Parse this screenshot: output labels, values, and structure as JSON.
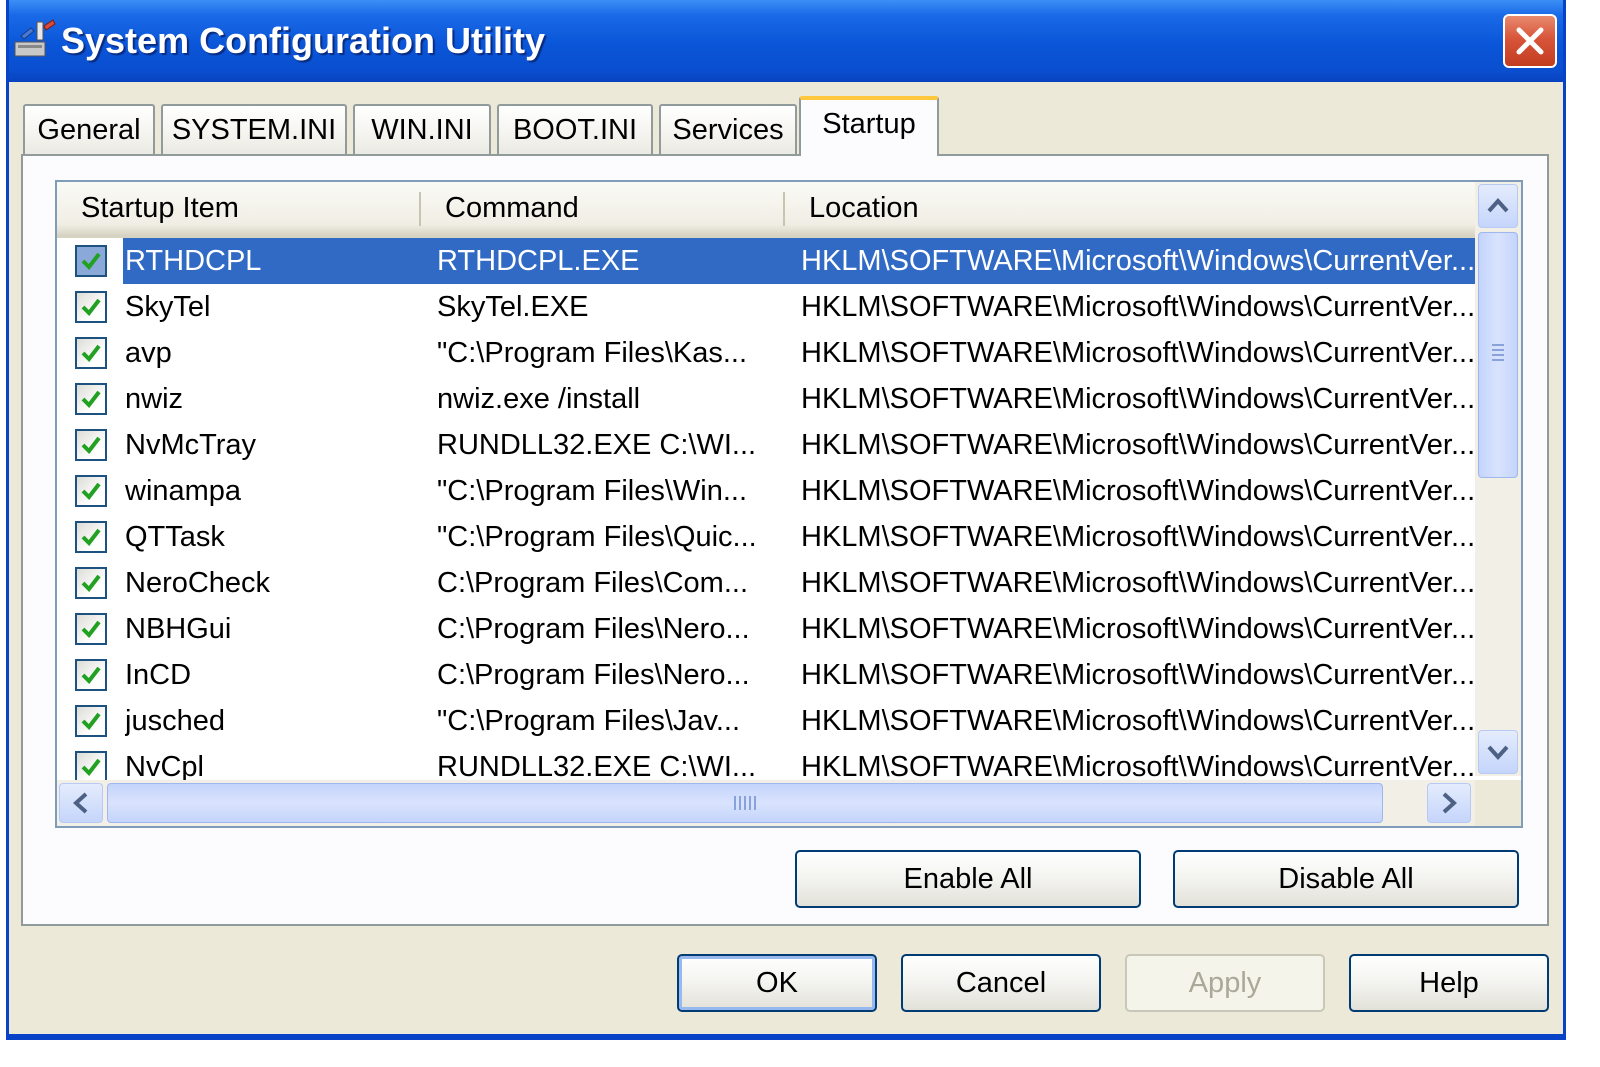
{
  "window": {
    "title": "System Configuration Utility"
  },
  "tabs": [
    {
      "label": "General",
      "active": false
    },
    {
      "label": "SYSTEM.INI",
      "active": false
    },
    {
      "label": "WIN.INI",
      "active": false
    },
    {
      "label": "BOOT.INI",
      "active": false
    },
    {
      "label": "Services",
      "active": false
    },
    {
      "label": "Startup",
      "active": true
    }
  ],
  "startup_list": {
    "columns": [
      "Startup Item",
      "Command",
      "Location"
    ],
    "rows": [
      {
        "checked": true,
        "item": "RTHDCPL",
        "command": "RTHDCPL.EXE",
        "location": "HKLM\\SOFTWARE\\Microsoft\\Windows\\CurrentVer...",
        "selected": true
      },
      {
        "checked": true,
        "item": "SkyTel",
        "command": "SkyTel.EXE",
        "location": "HKLM\\SOFTWARE\\Microsoft\\Windows\\CurrentVer..."
      },
      {
        "checked": true,
        "item": "avp",
        "command": "\"C:\\Program Files\\Kas...",
        "location": "HKLM\\SOFTWARE\\Microsoft\\Windows\\CurrentVer..."
      },
      {
        "checked": true,
        "item": "nwiz",
        "command": "nwiz.exe /install",
        "location": "HKLM\\SOFTWARE\\Microsoft\\Windows\\CurrentVer..."
      },
      {
        "checked": true,
        "item": "NvMcTray",
        "command": "RUNDLL32.EXE C:\\WI...",
        "location": "HKLM\\SOFTWARE\\Microsoft\\Windows\\CurrentVer..."
      },
      {
        "checked": true,
        "item": "winampa",
        "command": "\"C:\\Program Files\\Win...",
        "location": "HKLM\\SOFTWARE\\Microsoft\\Windows\\CurrentVer..."
      },
      {
        "checked": true,
        "item": "QTTask",
        "command": "\"C:\\Program Files\\Quic...",
        "location": "HKLM\\SOFTWARE\\Microsoft\\Windows\\CurrentVer..."
      },
      {
        "checked": true,
        "item": "NeroCheck",
        "command": "C:\\Program Files\\Com...",
        "location": "HKLM\\SOFTWARE\\Microsoft\\Windows\\CurrentVer..."
      },
      {
        "checked": true,
        "item": "NBHGui",
        "command": "C:\\Program Files\\Nero...",
        "location": "HKLM\\SOFTWARE\\Microsoft\\Windows\\CurrentVer..."
      },
      {
        "checked": true,
        "item": "InCD",
        "command": "C:\\Program Files\\Nero...",
        "location": "HKLM\\SOFTWARE\\Microsoft\\Windows\\CurrentVer..."
      },
      {
        "checked": true,
        "item": "jusched",
        "command": "\"C:\\Program Files\\Jav...",
        "location": "HKLM\\SOFTWARE\\Microsoft\\Windows\\CurrentVer..."
      },
      {
        "checked": true,
        "item": "NvCpl",
        "command": "RUNDLL32.EXE C:\\WI...",
        "location": "HKLM\\SOFTWARE\\Microsoft\\Windows\\CurrentVer..."
      }
    ]
  },
  "panel_buttons": {
    "enable_all": "Enable All",
    "disable_all": "Disable All"
  },
  "dialog_buttons": {
    "ok": "OK",
    "cancel": "Cancel",
    "apply": "Apply",
    "help": "Help"
  },
  "colors": {
    "selection": "#316ac5",
    "title_bar": "#0a55d8",
    "active_tab_accent": "#ffc83c"
  },
  "icons": [
    "msconfig-app-icon",
    "close-icon",
    "checkmark-icon",
    "scroll-up-icon",
    "scroll-down-icon",
    "scroll-left-icon",
    "scroll-right-icon",
    "grip-icon"
  ]
}
